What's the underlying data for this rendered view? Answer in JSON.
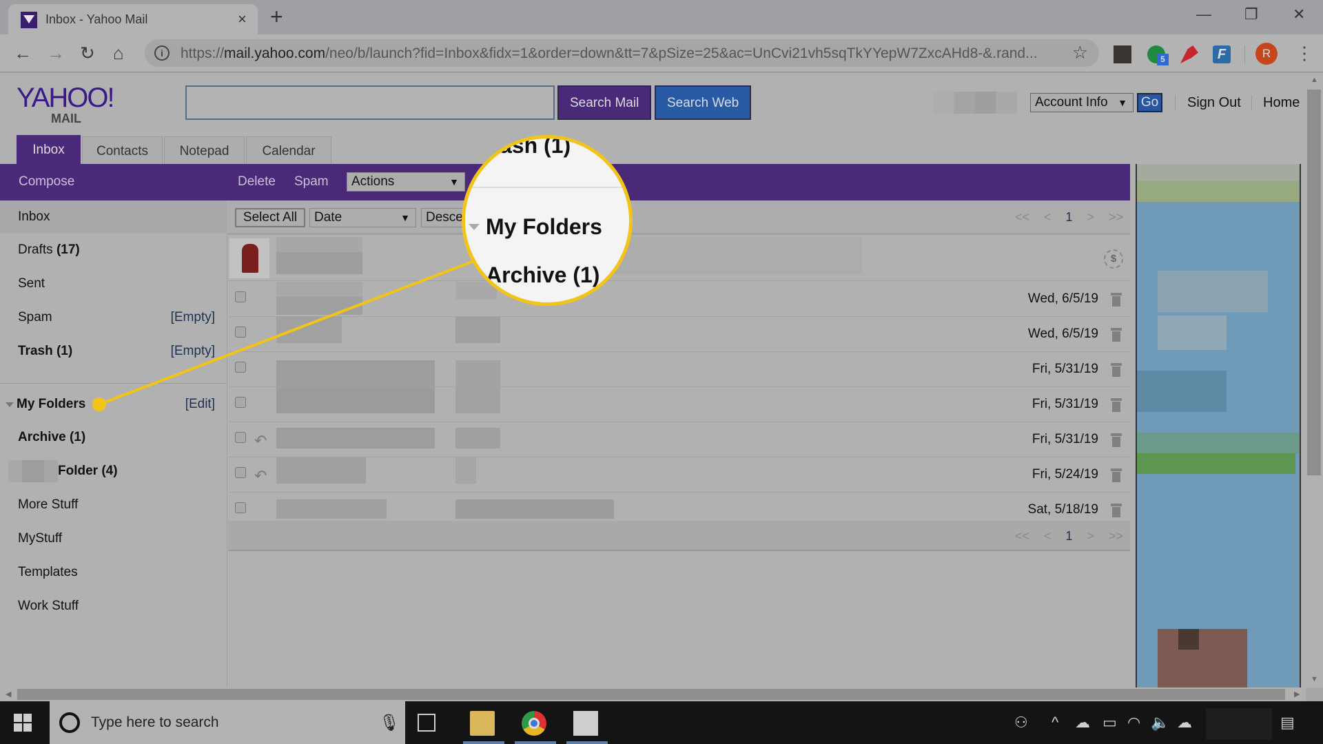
{
  "browser": {
    "tab_title": "Inbox - Yahoo Mail",
    "tab_close": "×",
    "new_tab": "+",
    "window_minimize": "—",
    "window_restore": "❐",
    "window_close": "✕",
    "nav": {
      "back": "←",
      "forward": "→",
      "reload": "↻",
      "home": "⌂"
    },
    "url_prefix": "https://",
    "url_host": "mail.yahoo.com",
    "url_rest": "/neo/b/launch?fid=Inbox&fidx=1&order=down&tt=7&pSize=25&ac=UnCvi21vh5sqTkYYepW7ZxcAHd8-&.rand...",
    "bookmark_icon": "☆",
    "extensions": [
      {
        "name": "photo-extension",
        "color": "#3a3431"
      },
      {
        "name": "green-chat-extension",
        "color": "#1f8a3f",
        "badge": "5"
      },
      {
        "name": "cardinal-extension",
        "color": "#c8262c"
      },
      {
        "name": "f-extension",
        "color": "#2e6aa6"
      }
    ],
    "profile_initial": "R",
    "profile_color": "#c5461d",
    "menu_icon": "⋮"
  },
  "header": {
    "logo_main": "YAHOO!",
    "logo_sub": "MAIL",
    "search_value": "",
    "search_mail_label": "Search Mail",
    "search_web_label": "Search Web",
    "account_select": "Account Info",
    "go_label": "Go",
    "sign_out": "Sign Out",
    "home": "Home"
  },
  "tabs": [
    {
      "label": "Inbox",
      "active": true
    },
    {
      "label": "Contacts"
    },
    {
      "label": "Notepad"
    },
    {
      "label": "Calendar"
    }
  ],
  "toolbar": {
    "compose": "Compose",
    "delete": "Delete",
    "spam": "Spam",
    "actions": "Actions"
  },
  "sidebar": {
    "folders": [
      {
        "label": "Inbox",
        "count": ""
      },
      {
        "label": "Drafts",
        "count": "(17)"
      },
      {
        "label": "Sent",
        "count": ""
      },
      {
        "label": "Spam",
        "count": "",
        "action": "[Empty]"
      },
      {
        "label": "Trash (1)",
        "count": "",
        "action": "[Empty]"
      }
    ],
    "my_folders_label": "My Folders",
    "my_folders_edit": "[Edit]",
    "custom_folders": [
      {
        "label": "Archive (1)"
      },
      {
        "label": "Folder (4)"
      },
      {
        "label": "More Stuff"
      },
      {
        "label": "MyStuff"
      },
      {
        "label": "Templates"
      },
      {
        "label": "Work Stuff"
      }
    ]
  },
  "list": {
    "select_all": "Select All",
    "sort_by": "Date",
    "sort_dir": "Descending",
    "pager": {
      "first": "<<",
      "prev": "<",
      "current": "1",
      "next": ">",
      "last": ">>"
    },
    "sponsored_icon": "$",
    "messages": [
      {
        "date": "Wed, 6/5/19",
        "replied": false
      },
      {
        "date": "Wed, 6/5/19",
        "replied": false
      },
      {
        "date": "Fri, 5/31/19",
        "replied": false
      },
      {
        "date": "Fri, 5/31/19",
        "replied": false
      },
      {
        "date": "Fri, 5/31/19",
        "replied": true
      },
      {
        "date": "Fri, 5/24/19",
        "replied": true
      },
      {
        "date": "Sat, 5/18/19",
        "replied": false
      }
    ]
  },
  "callout": {
    "partial_text": "ash (1)",
    "line1": "My Folders",
    "line2": "Archive (1)",
    "color": "#f2c418"
  },
  "taskbar": {
    "search_placeholder": "Type here to search",
    "apps": [
      "task-view",
      "file-explorer",
      "chrome",
      "photos"
    ]
  }
}
